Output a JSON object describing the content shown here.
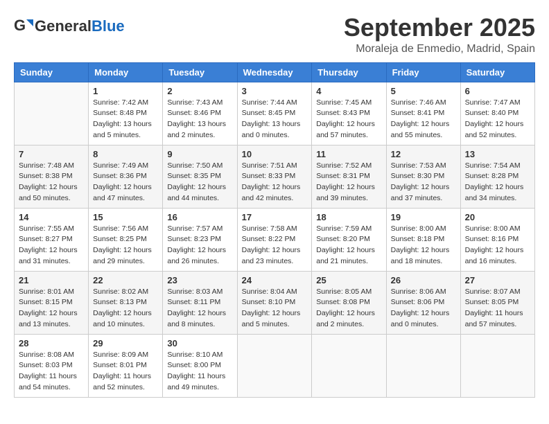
{
  "header": {
    "logo_general": "General",
    "logo_blue": "Blue",
    "month": "September 2025",
    "location": "Moraleja de Enmedio, Madrid, Spain"
  },
  "days_of_week": [
    "Sunday",
    "Monday",
    "Tuesday",
    "Wednesday",
    "Thursday",
    "Friday",
    "Saturday"
  ],
  "weeks": [
    [
      {
        "day": "",
        "info": ""
      },
      {
        "day": "1",
        "info": "Sunrise: 7:42 AM\nSunset: 8:48 PM\nDaylight: 13 hours\nand 5 minutes."
      },
      {
        "day": "2",
        "info": "Sunrise: 7:43 AM\nSunset: 8:46 PM\nDaylight: 13 hours\nand 2 minutes."
      },
      {
        "day": "3",
        "info": "Sunrise: 7:44 AM\nSunset: 8:45 PM\nDaylight: 13 hours\nand 0 minutes."
      },
      {
        "day": "4",
        "info": "Sunrise: 7:45 AM\nSunset: 8:43 PM\nDaylight: 12 hours\nand 57 minutes."
      },
      {
        "day": "5",
        "info": "Sunrise: 7:46 AM\nSunset: 8:41 PM\nDaylight: 12 hours\nand 55 minutes."
      },
      {
        "day": "6",
        "info": "Sunrise: 7:47 AM\nSunset: 8:40 PM\nDaylight: 12 hours\nand 52 minutes."
      }
    ],
    [
      {
        "day": "7",
        "info": "Sunrise: 7:48 AM\nSunset: 8:38 PM\nDaylight: 12 hours\nand 50 minutes."
      },
      {
        "day": "8",
        "info": "Sunrise: 7:49 AM\nSunset: 8:36 PM\nDaylight: 12 hours\nand 47 minutes."
      },
      {
        "day": "9",
        "info": "Sunrise: 7:50 AM\nSunset: 8:35 PM\nDaylight: 12 hours\nand 44 minutes."
      },
      {
        "day": "10",
        "info": "Sunrise: 7:51 AM\nSunset: 8:33 PM\nDaylight: 12 hours\nand 42 minutes."
      },
      {
        "day": "11",
        "info": "Sunrise: 7:52 AM\nSunset: 8:31 PM\nDaylight: 12 hours\nand 39 minutes."
      },
      {
        "day": "12",
        "info": "Sunrise: 7:53 AM\nSunset: 8:30 PM\nDaylight: 12 hours\nand 37 minutes."
      },
      {
        "day": "13",
        "info": "Sunrise: 7:54 AM\nSunset: 8:28 PM\nDaylight: 12 hours\nand 34 minutes."
      }
    ],
    [
      {
        "day": "14",
        "info": "Sunrise: 7:55 AM\nSunset: 8:27 PM\nDaylight: 12 hours\nand 31 minutes."
      },
      {
        "day": "15",
        "info": "Sunrise: 7:56 AM\nSunset: 8:25 PM\nDaylight: 12 hours\nand 29 minutes."
      },
      {
        "day": "16",
        "info": "Sunrise: 7:57 AM\nSunset: 8:23 PM\nDaylight: 12 hours\nand 26 minutes."
      },
      {
        "day": "17",
        "info": "Sunrise: 7:58 AM\nSunset: 8:22 PM\nDaylight: 12 hours\nand 23 minutes."
      },
      {
        "day": "18",
        "info": "Sunrise: 7:59 AM\nSunset: 8:20 PM\nDaylight: 12 hours\nand 21 minutes."
      },
      {
        "day": "19",
        "info": "Sunrise: 8:00 AM\nSunset: 8:18 PM\nDaylight: 12 hours\nand 18 minutes."
      },
      {
        "day": "20",
        "info": "Sunrise: 8:00 AM\nSunset: 8:16 PM\nDaylight: 12 hours\nand 16 minutes."
      }
    ],
    [
      {
        "day": "21",
        "info": "Sunrise: 8:01 AM\nSunset: 8:15 PM\nDaylight: 12 hours\nand 13 minutes."
      },
      {
        "day": "22",
        "info": "Sunrise: 8:02 AM\nSunset: 8:13 PM\nDaylight: 12 hours\nand 10 minutes."
      },
      {
        "day": "23",
        "info": "Sunrise: 8:03 AM\nSunset: 8:11 PM\nDaylight: 12 hours\nand 8 minutes."
      },
      {
        "day": "24",
        "info": "Sunrise: 8:04 AM\nSunset: 8:10 PM\nDaylight: 12 hours\nand 5 minutes."
      },
      {
        "day": "25",
        "info": "Sunrise: 8:05 AM\nSunset: 8:08 PM\nDaylight: 12 hours\nand 2 minutes."
      },
      {
        "day": "26",
        "info": "Sunrise: 8:06 AM\nSunset: 8:06 PM\nDaylight: 12 hours\nand 0 minutes."
      },
      {
        "day": "27",
        "info": "Sunrise: 8:07 AM\nSunset: 8:05 PM\nDaylight: 11 hours\nand 57 minutes."
      }
    ],
    [
      {
        "day": "28",
        "info": "Sunrise: 8:08 AM\nSunset: 8:03 PM\nDaylight: 11 hours\nand 54 minutes."
      },
      {
        "day": "29",
        "info": "Sunrise: 8:09 AM\nSunset: 8:01 PM\nDaylight: 11 hours\nand 52 minutes."
      },
      {
        "day": "30",
        "info": "Sunrise: 8:10 AM\nSunset: 8:00 PM\nDaylight: 11 hours\nand 49 minutes."
      },
      {
        "day": "",
        "info": ""
      },
      {
        "day": "",
        "info": ""
      },
      {
        "day": "",
        "info": ""
      },
      {
        "day": "",
        "info": ""
      }
    ]
  ]
}
